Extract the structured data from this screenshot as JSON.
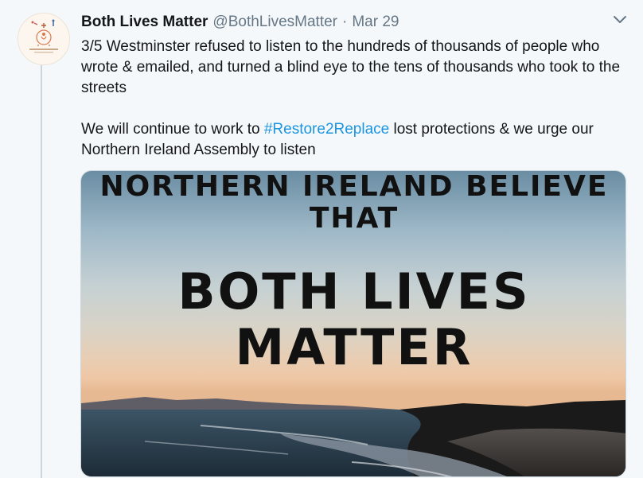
{
  "tweet": {
    "display_name": "Both Lives Matter",
    "handle": "@BothLivesMatter",
    "separator": "·",
    "timestamp": "Mar 29",
    "avatar_icon": "both-lives-matter-logo",
    "caret_icon": "chevron-down-icon",
    "text": {
      "para1": "3/5 Westminster refused to listen to the hundreds of thousands of people who wrote & emailed, and turned a blind eye to the tens of thousands who took to the streets",
      "para2_before": "We will continue to work to ",
      "hashtag": "#Restore2Replace",
      "para2_after": " lost protections & we urge our Northern Ireland Assembly to listen"
    },
    "media": {
      "line1": "NORTHERN IRELAND BELIEVE",
      "line2": "THAT",
      "line3": "BOTH LIVES",
      "line4": "MATTER"
    }
  },
  "colors": {
    "background": "#f5f8fa",
    "text": "#14171a",
    "secondary": "#657786",
    "link": "#1b95e0",
    "thread_line": "#ccd6dd"
  }
}
